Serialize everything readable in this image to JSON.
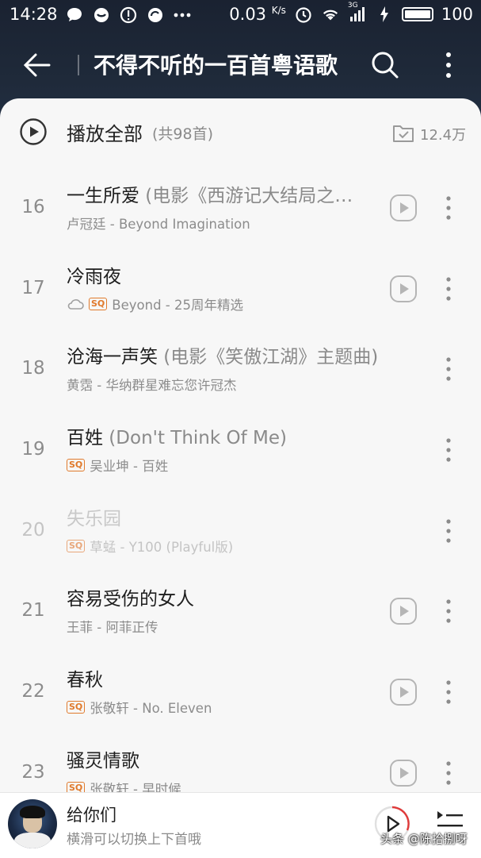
{
  "status_bar": {
    "time": "14:28",
    "net_speed": "0.03",
    "net_unit": "K/s",
    "network": "3G",
    "battery": "100"
  },
  "app_bar": {
    "title": "不得不听的一百首粤语歌"
  },
  "play_all": {
    "label": "播放全部",
    "count": "(共98首)",
    "favorites": "12.4万"
  },
  "songs": [
    {
      "num": "16",
      "title": "一生所爱",
      "extra": " (电影《西游记大结局之…",
      "artist_album": "卢冠廷 - Beyond Imagination",
      "sq": false,
      "cloud": false,
      "mv": true
    },
    {
      "num": "17",
      "title": "冷雨夜",
      "extra": "",
      "artist_album": "Beyond - 25周年精选",
      "sq": true,
      "cloud": true,
      "mv": true
    },
    {
      "num": "18",
      "title": "沧海一声笑",
      "extra": " (电影《笑傲江湖》主题曲)",
      "artist_album": "黄霑 - 华纳群星难忘您许冠杰",
      "sq": false,
      "cloud": false,
      "mv": false
    },
    {
      "num": "19",
      "title": "百姓",
      "extra": " (Don't Think Of Me)",
      "artist_album": "吴业坤 - 百姓",
      "sq": true,
      "cloud": false,
      "mv": false
    },
    {
      "num": "20",
      "title": "失乐园",
      "extra": "",
      "artist_album": "草蜢 - Y100 (Playful版)",
      "sq": true,
      "cloud": false,
      "mv": false
    },
    {
      "num": "21",
      "title": "容易受伤的女人",
      "extra": "",
      "artist_album": "王菲 - 阿菲正传",
      "sq": false,
      "cloud": false,
      "mv": true
    },
    {
      "num": "22",
      "title": "春秋",
      "extra": "",
      "artist_album": "张敬轩 - No. Eleven",
      "sq": true,
      "cloud": false,
      "mv": true
    },
    {
      "num": "23",
      "title": "骚灵情歌",
      "extra": "",
      "artist_album": "张敬轩 - 早时候",
      "sq": true,
      "cloud": false,
      "mv": true
    }
  ],
  "sq_badge": "SQ",
  "player": {
    "song": "给你们",
    "hint": "横滑可以切换上下首哦"
  },
  "watermark": "头条 @陈拾捌呀",
  "colors": {
    "header_bg": "#1f2a3a",
    "sheet_bg": "#f7f7f7",
    "sq_orange": "#e07a2c",
    "play_red": "#e03a3a"
  }
}
